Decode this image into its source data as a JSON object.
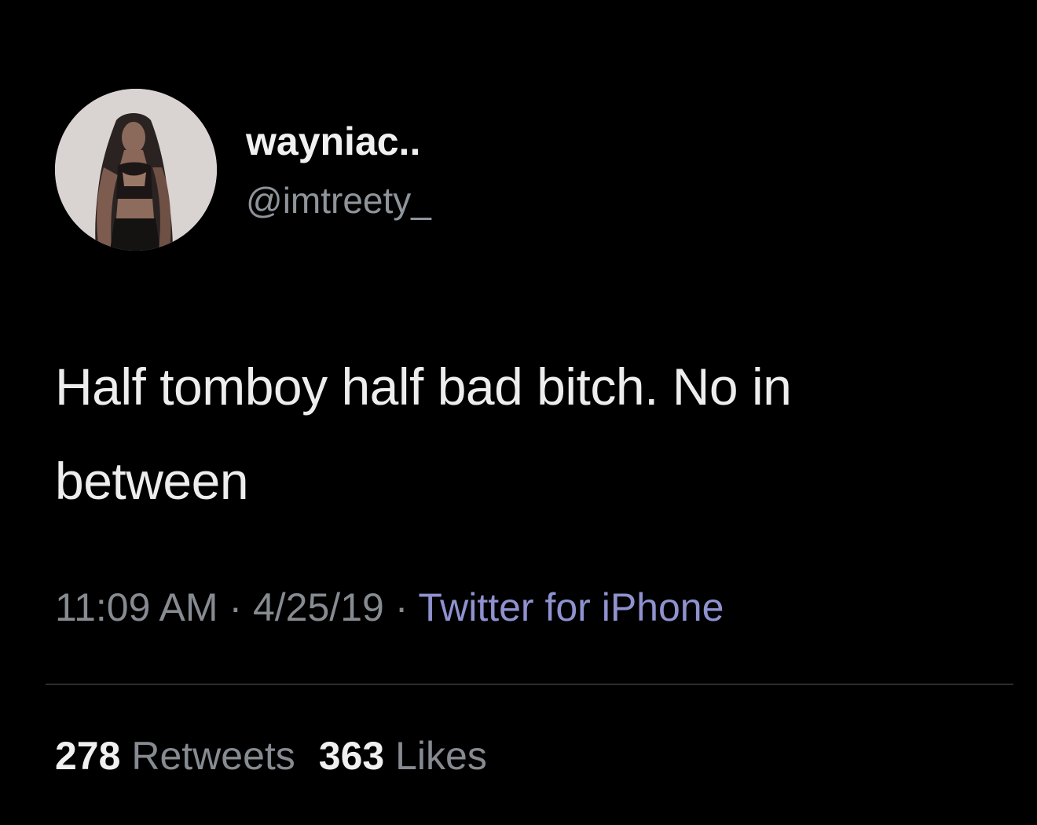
{
  "tweet": {
    "display_name": "wayniac..",
    "handle": "@imtreety_",
    "avatar_icon": "profile-photo",
    "text": "Half tomboy half bad bitch. No in between",
    "time": "11:09 AM",
    "separator": " · ",
    "date": "4/25/19",
    "source": "Twitter for iPhone",
    "retweets_count": "278",
    "retweets_label": "Retweets",
    "likes_count": "363",
    "likes_label": "Likes"
  },
  "colors": {
    "background": "#000000",
    "primary_text": "#ededed",
    "secondary_text": "#868b91",
    "source_link": "#8f92cf",
    "divider": "#2c2c2e"
  }
}
